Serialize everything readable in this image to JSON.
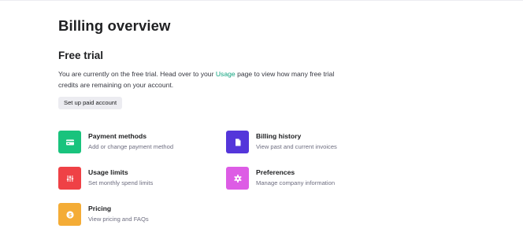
{
  "page": {
    "title": "Billing overview"
  },
  "free_trial": {
    "heading": "Free trial",
    "text_before": "You are currently on the free trial. Head over to your ",
    "link_text": "Usage",
    "text_after": " page to view how many free trial credits are remaining on your account.",
    "button_label": "Set up paid account"
  },
  "cards": {
    "payment_methods": {
      "title": "Payment methods",
      "subtitle": "Add or change payment method",
      "icon": "credit-card-icon",
      "color": "#19c37d"
    },
    "billing_history": {
      "title": "Billing history",
      "subtitle": "View past and current invoices",
      "icon": "document-icon",
      "color": "#5436da"
    },
    "usage_limits": {
      "title": "Usage limits",
      "subtitle": "Set monthly spend limits",
      "icon": "sliders-icon",
      "color": "#ef4146"
    },
    "preferences": {
      "title": "Preferences",
      "subtitle": "Manage company information",
      "icon": "gear-icon",
      "color": "#dd5ce5"
    },
    "pricing": {
      "title": "Pricing",
      "subtitle": "View pricing and FAQs",
      "icon": "dollar-coin-icon",
      "color": "#f4ac36"
    }
  }
}
